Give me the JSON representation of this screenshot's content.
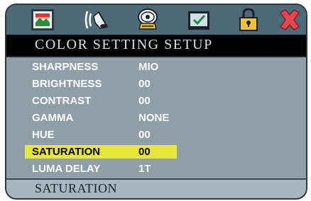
{
  "tabs": [
    {
      "icon": "picture-icon"
    },
    {
      "icon": "speaker-icon"
    },
    {
      "icon": "film-reel-icon"
    },
    {
      "icon": "checkmark-monitor-icon"
    },
    {
      "icon": "lock-icon"
    },
    {
      "icon": "close-icon"
    }
  ],
  "title": "COLOR SETTING SETUP",
  "settings": [
    {
      "label": "SHARPNESS",
      "value": "MIO"
    },
    {
      "label": "BRIGHTNESS",
      "value": "00"
    },
    {
      "label": "CONTRAST",
      "value": "00"
    },
    {
      "label": "GAMMA",
      "value": "NONE"
    },
    {
      "label": "HUE",
      "value": "00"
    },
    {
      "label": "SATURATION",
      "value": "00"
    },
    {
      "label": "LUMA DELAY",
      "value": "1T"
    }
  ],
  "selected_setting": "SATURATION",
  "status_text": "SATURATION",
  "colors": {
    "tabbar": "#4f6a77",
    "panel": "#8e9fa8",
    "highlight": "#e6e63c",
    "close": "#e8464d"
  }
}
